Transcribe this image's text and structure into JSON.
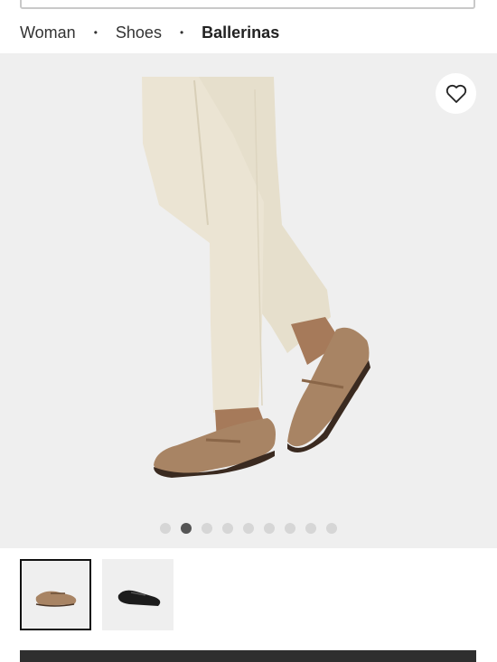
{
  "breadcrumb": {
    "items": [
      "Woman",
      "Shoes",
      "Ballerinas"
    ],
    "separator": "•"
  },
  "gallery": {
    "image_icon": "product-photo-beige-trousers-brown-ballerinas",
    "wishlist_icon": "heart-icon",
    "dot_count": 9,
    "active_dot": 2
  },
  "thumbnails": [
    {
      "icon": "brown-ballerina-thumbnail",
      "selected": true
    },
    {
      "icon": "black-ballerina-thumbnail",
      "selected": false
    }
  ],
  "colors": {
    "trousers": "#ebe4d3",
    "shoe_brown": "#a88464",
    "shoe_black": "#1c1c1c",
    "gallery_bg": "#efefef",
    "cta_bg": "#2f2f2f"
  }
}
